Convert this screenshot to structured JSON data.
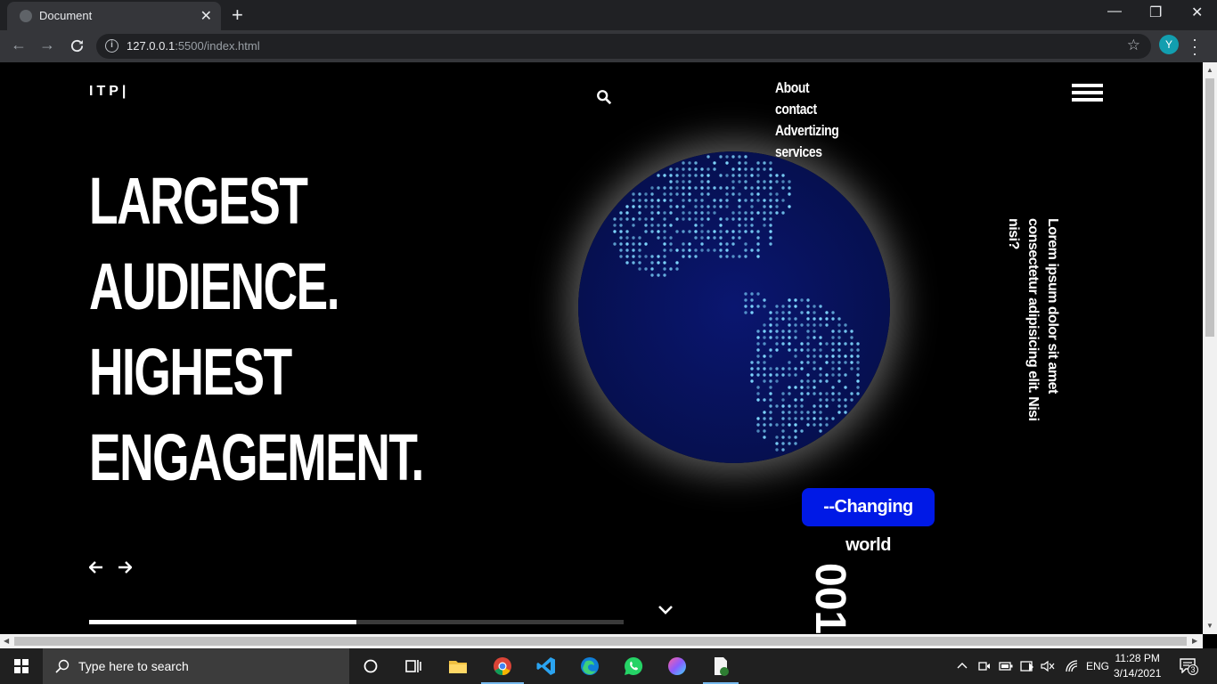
{
  "browser": {
    "tab_title": "Document",
    "tab_close": "✕",
    "new_tab": "+",
    "url_host": "127.0.0.1",
    "url_rest": ":5500/index.html",
    "profile_initial": "Y",
    "window_minimize": "—",
    "window_restore": "❐",
    "window_close": "✕"
  },
  "page": {
    "logo": "ITP|",
    "nav_links": [
      "About",
      "contact",
      "Advertizing",
      "services"
    ],
    "headline": [
      "LARGEST",
      "AUDIENCE.",
      "HIGHEST",
      "ENGAGEMENT."
    ],
    "vertical_text": "Lorem ipsum dolor sit amet consectetur adipisicing elit. Nisi nisi?",
    "badge": "--Changing world",
    "counter": "001",
    "prev_arrow": "🡐",
    "next_arrow": "🡒",
    "slide_progress": 0.5
  },
  "taskbar": {
    "search_placeholder": "Type here to search",
    "language": "ENG",
    "time": "11:28 PM",
    "date": "3/14/2021",
    "notification_count": "3"
  },
  "colors": {
    "accent_badge": "#0019e6",
    "globe": "#061050",
    "map_dots": "#7fd8ff"
  }
}
